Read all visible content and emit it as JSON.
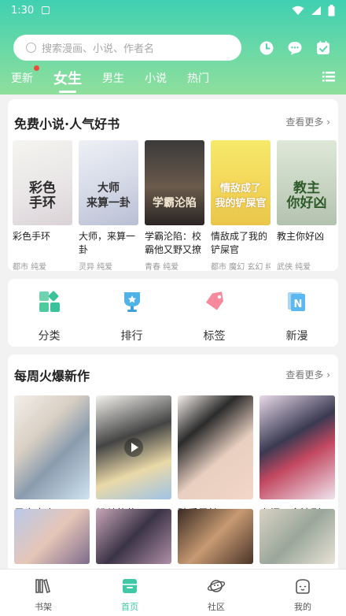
{
  "status": {
    "time": "1:30"
  },
  "search": {
    "placeholder": "搜索漫画、小说、作者名"
  },
  "tabs": [
    {
      "label": "更新"
    },
    {
      "label": "女生"
    },
    {
      "label": "男生"
    },
    {
      "label": "小说"
    },
    {
      "label": "热门"
    }
  ],
  "novels": {
    "title": "免费小说·人气好书",
    "more": "查看更多",
    "items": [
      {
        "title": "彩色手环",
        "tags": "都市 纯爱",
        "cover_text": "彩色\n手环"
      },
      {
        "title": "大师，来算一卦",
        "tags": "灵异 纯爱",
        "cover_text": "大师\n来算一卦"
      },
      {
        "title": "学霸沦陷：校霸他又野又撩",
        "tags": "青春 纯爱",
        "cover_text": "学霸沦陷"
      },
      {
        "title": "情敌成了我的铲屎官",
        "tags": "都市 魔幻 玄幻 纯",
        "cover_text": "情敌成了\n我的铲屎官"
      },
      {
        "title": "教主你好凶",
        "tags": "武侠 纯爱",
        "cover_text": "教主\n你好凶"
      }
    ]
  },
  "categories": [
    {
      "label": "分类",
      "icon": "grid-icon"
    },
    {
      "label": "排行",
      "icon": "trophy-icon"
    },
    {
      "label": "标签",
      "icon": "tag-icon"
    },
    {
      "label": "新漫",
      "icon": "new-icon"
    }
  ],
  "weekly": {
    "title": "每周火爆新作",
    "more": "查看更多",
    "items": [
      {
        "title": "星空恋人"
      },
      {
        "title": "粉丝的信"
      },
      {
        "title": "醉爱男神"
      },
      {
        "title": "人烟不食法则"
      }
    ]
  },
  "bottom_nav": [
    {
      "label": "书架",
      "icon": "bookshelf-icon"
    },
    {
      "label": "首页",
      "icon": "home-icon"
    },
    {
      "label": "社区",
      "icon": "planet-icon"
    },
    {
      "label": "我的",
      "icon": "profile-icon"
    }
  ],
  "colors": {
    "accent": "#3dc9a6",
    "badge": "#f04a3c"
  }
}
